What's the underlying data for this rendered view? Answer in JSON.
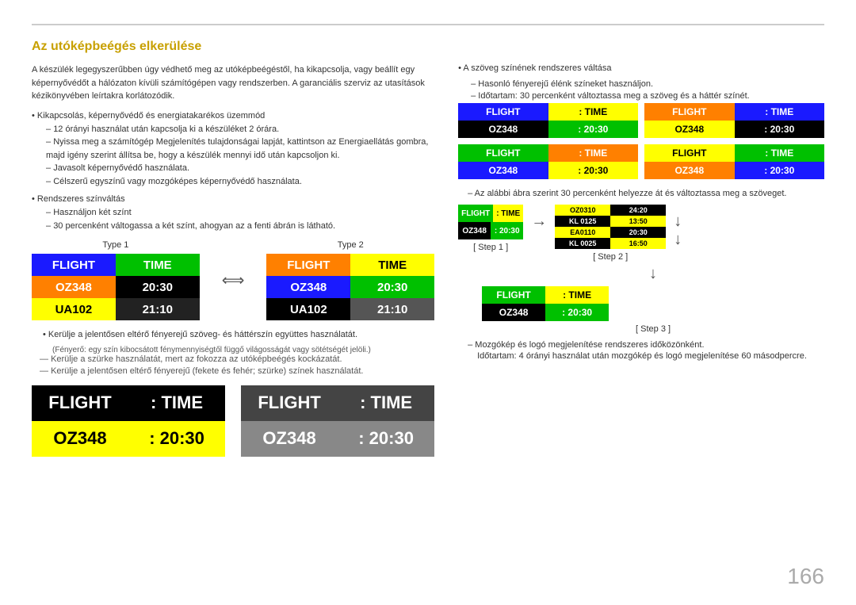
{
  "page": {
    "number": "166"
  },
  "title": "Az utóképbeégés elkerülése",
  "intro": "A készülék legegyszerűbben úgy védhető meg az utóképbeégéstől, ha kikapcsolja, vagy beállít egy képernyővédőt a hálózaton kívüli számítógépen vagy rendszerben. A garanciális szerviz az utasítások kézikönyvében leírtakra korlátozódik.",
  "bullets": [
    {
      "title": "Kikapcsolás, képernyővédő és energiatakarékos üzemmód",
      "subs": [
        "12 órányi használat után kapcsolja ki a készüléket 2 órára.",
        "Nyissa meg a számítógép Megjelenítés tulajdonságai lapját, kattintson az Energiaellátás gombra, majd igény szerint állítsa be, hogy a készülék mennyi idő után kapcsoljon ki.",
        "Javasolt képernyővédő használata.",
        "Célszerű egyszínű vagy mozgóképes képernyővédő használata."
      ]
    },
    {
      "title": "Rendszeres színváltás",
      "subs": [
        "Használjon két színt",
        "30 percenként váltogassa a két színt, ahogyan az a fenti ábrán is látható."
      ]
    }
  ],
  "warn_rows": [
    "Kerülje a jelentősen eltérő fényerejű szöveg- és háttérszín együttes használatát.",
    "Kerülje a szürke használatát, mert az fokozza az utóképbeégés kockázatát.",
    "Kerülje a jelentősen eltérő fényerejű (fekete és fehér; szürke) színek használatát."
  ],
  "type_labels": [
    "Type 1",
    "Type 2"
  ],
  "boards": {
    "type1": {
      "rows": [
        [
          {
            "text": "FLIGHT",
            "cls": "cell-blue"
          },
          {
            "text": "TIME",
            "cls": "cell-green"
          }
        ],
        [
          {
            "text": "OZ348",
            "cls": "cell-orange"
          },
          {
            "text": "20:30",
            "cls": "cell-black"
          }
        ],
        [
          {
            "text": "UA102",
            "cls": "cell-yellow"
          },
          {
            "text": "21:10",
            "cls": "cell-dark"
          }
        ]
      ]
    },
    "type2": {
      "rows": [
        [
          {
            "text": "FLIGHT",
            "cls": "cell-orange"
          },
          {
            "text": "TIME",
            "cls": "cell-yellow"
          }
        ],
        [
          {
            "text": "OZ348",
            "cls": "cell-blue"
          },
          {
            "text": "20:30",
            "cls": "cell-green"
          }
        ],
        [
          {
            "text": "UA102",
            "cls": "cell-black"
          },
          {
            "text": "21:10",
            "cls": "cell-darkgray"
          }
        ]
      ]
    }
  },
  "right_col": {
    "intro": "A szöveg színének rendszeres váltása",
    "sub": "Hasonló fényerejű élénk színeket használjon.",
    "sub2": "Időtartam: 30 percenként változtassa meg a szöveg és a háttér színét.",
    "color_boards": [
      {
        "rows": [
          [
            {
              "text": "FLIGHT",
              "cls": "mini-blue"
            },
            {
              "text": "TIME",
              "cls": "mini-yellow"
            }
          ],
          [
            {
              "text": "OZ348",
              "cls": "mini-black"
            },
            {
              "text": "20:30",
              "cls": "mini-green"
            }
          ]
        ]
      },
      {
        "rows": [
          [
            {
              "text": "FLIGHT",
              "cls": "mini-orange"
            },
            {
              "text": "TIME",
              "cls": "mini-blue"
            }
          ],
          [
            {
              "text": "OZ348",
              "cls": "mini-yellow"
            },
            {
              "text": "20:30",
              "cls": "mini-black"
            }
          ]
        ]
      },
      {
        "rows": [
          [
            {
              "text": "FLIGHT",
              "cls": "mini-green"
            },
            {
              "text": "TIME",
              "cls": "mini-orange"
            }
          ],
          [
            {
              "text": "OZ348",
              "cls": "mini-blue"
            },
            {
              "text": "20:30",
              "cls": "mini-yellow"
            }
          ]
        ]
      },
      {
        "rows": [
          [
            {
              "text": "FLIGHT",
              "cls": "mini-yellow"
            },
            {
              "text": "TIME",
              "cls": "mini-green"
            }
          ],
          [
            {
              "text": "OZ348",
              "cls": "mini-orange"
            },
            {
              "text": "20:30",
              "cls": "mini-blue"
            }
          ]
        ]
      }
    ],
    "step_note": "Az alábbi ábra szerint 30 percenként helyezze át és változtassa meg a szöveget.",
    "step_labels": [
      "[ Step 1 ]",
      "[ Step 2 ]",
      "[ Step 3 ]"
    ],
    "step2_rows": [
      [
        {
          "text": "OZ0310",
          "cls": "mini-yellow"
        },
        {
          "text": "24:20",
          "cls": "mini-black"
        }
      ],
      [
        {
          "text": "KL 0125",
          "cls": "mini-black"
        },
        {
          "text": "13:50",
          "cls": "mini-yellow"
        }
      ],
      [
        {
          "text": "EA0110",
          "cls": "mini-yellow"
        },
        {
          "text": "20:30",
          "cls": "mini-black"
        }
      ],
      [
        {
          "text": "KL 0025",
          "cls": "mini-black"
        },
        {
          "text": "16:50",
          "cls": "mini-yellow"
        }
      ]
    ],
    "bottom_note": "Mozgókép és logó megjelenítése rendszeres időközönként.",
    "bottom_sub": "Időtartam: 4 órányi használat után mozgókép és logó megjelenítése 60 másodpercre."
  },
  "bottom_boards": {
    "board1": {
      "rows": [
        [
          {
            "text": "FLIGHT",
            "cls": "big-black"
          },
          {
            "text": "TIME",
            "cls": "big-black"
          }
        ],
        [
          {
            "text": "OZ348",
            "cls": "big-yellow"
          },
          {
            "text": "20:30",
            "cls": "big-yellow"
          }
        ]
      ]
    },
    "board2": {
      "rows": [
        [
          {
            "text": "FLIGHT",
            "cls": "big-darkgray"
          },
          {
            "text": "TIME",
            "cls": "big-darkgray"
          }
        ],
        [
          {
            "text": "OZ348",
            "cls": "big-gray"
          },
          {
            "text": "20:30",
            "cls": "big-gray"
          }
        ]
      ]
    }
  },
  "warn_label": "(Fényerő: egy szín kibocsátott fénymennyiségtől függő világosságát vagy sötétségét jelöli.)"
}
